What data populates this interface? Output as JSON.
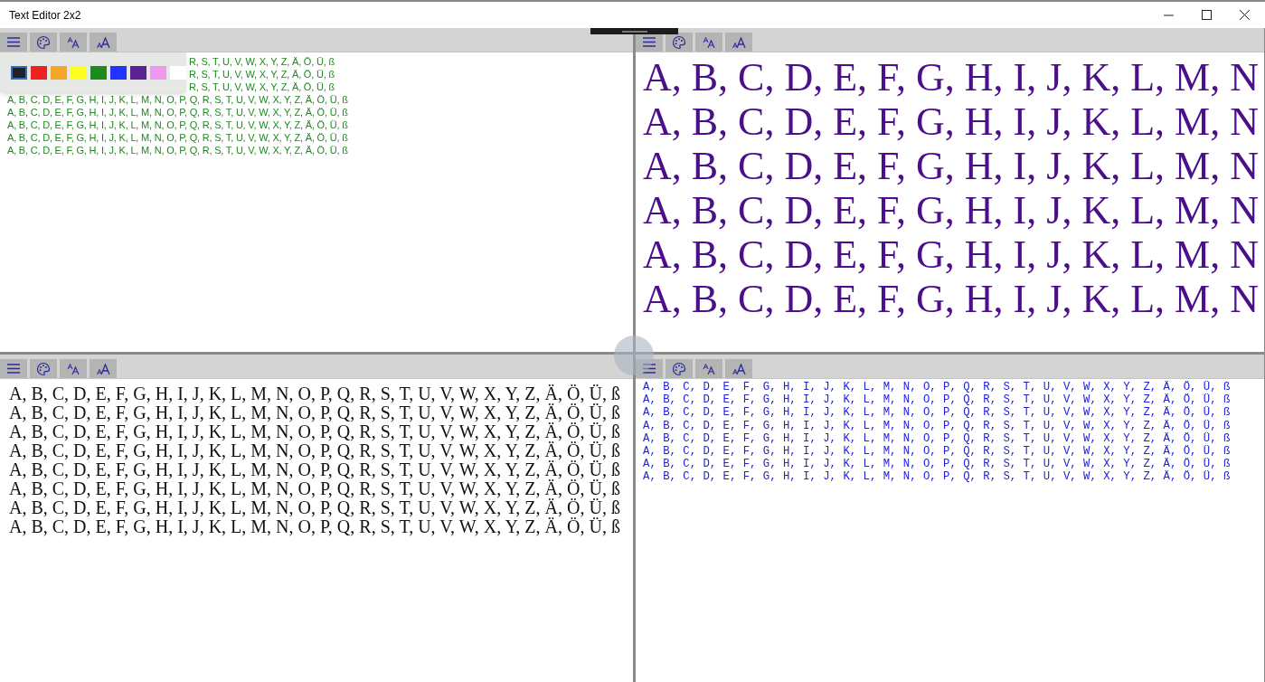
{
  "window": {
    "title": "Text Editor 2x2"
  },
  "panes": [
    {
      "kind": "small-sans",
      "color": "#1e8a1e",
      "color_popup": {
        "swatches": [
          {
            "color": "#222222",
            "selected": true
          },
          {
            "color": "#ee2222",
            "selected": false
          },
          {
            "color": "#f5a623",
            "selected": false
          },
          {
            "color": "#ffff22",
            "selected": false
          },
          {
            "color": "#1e8a1e",
            "selected": false
          },
          {
            "color": "#2233ff",
            "selected": false
          },
          {
            "color": "#5b2293",
            "selected": false
          },
          {
            "color": "#ee99ee",
            "selected": false
          },
          {
            "color": "#ffffff",
            "selected": false
          }
        ]
      },
      "partial_lines": [
        "R, S, T, U, V, W, X, Y, Z, Ä, Ö, Ü, ß",
        "R, S, T, U, V, W, X, Y, Z, Ä, Ö, Ü, ß",
        "R, S, T, U, V, W, X, Y, Z, Ä, Ö, Ü, ß"
      ],
      "lines": [
        "A, B, C, D, E, F, G, H, I, J, K, L, M, N, O, P, Q, R, S, T, U, V, W, X, Y, Z, Ä, Ö, Ü, ß",
        "A, B, C, D, E, F, G, H, I, J, K, L, M, N, O, P, Q, R, S, T, U, V, W, X, Y, Z, Ä, Ö, Ü, ß",
        "A, B, C, D, E, F, G, H, I, J, K, L, M, N, O, P, Q, R, S, T, U, V, W, X, Y, Z, Ä, Ö, Ü, ß",
        "A, B, C, D, E, F, G, H, I, J, K, L, M, N, O, P, Q, R, S, T, U, V, W, X, Y, Z, Ä, Ö, Ü, ß",
        "A, B, C, D, E, F, G, H, I, J, K, L, M, N, O, P, Q, R, S, T, U, V, W, X, Y, Z, Ä, Ö, Ü, ß"
      ]
    },
    {
      "kind": "large-serif",
      "color": "#4b0f8a",
      "lines": [
        "A, B, C, D, E, F, G, H, I, J, K, L, M, N",
        "A, B, C, D, E, F, G, H, I, J, K, L, M, N",
        "A, B, C, D, E, F, G, H, I, J, K, L, M, N",
        "A, B, C, D, E, F, G, H, I, J, K, L, M, N",
        "A, B, C, D, E, F, G, H, I, J, K, L, M, N",
        "A, B, C, D, E, F, G, H, I, J, K, L, M, N"
      ]
    },
    {
      "kind": "serif",
      "color": "#111111",
      "lines": [
        "A, B, C, D, E, F, G, H, I, J, K, L, M, N, O, P, Q, R, S, T, U, V, W, X, Y, Z, Ä, Ö, Ü, ß",
        "A, B, C, D, E, F, G, H, I, J, K, L, M, N, O, P, Q, R, S, T, U, V, W, X, Y, Z, Ä, Ö, Ü, ß",
        "A, B, C, D, E, F, G, H, I, J, K, L, M, N, O, P, Q, R, S, T, U, V, W, X, Y, Z, Ä, Ö, Ü, ß",
        "A, B, C, D, E, F, G, H, I, J, K, L, M, N, O, P, Q, R, S, T, U, V, W, X, Y, Z, Ä, Ö, Ü, ß",
        "A, B, C, D, E, F, G, H, I, J, K, L, M, N, O, P, Q, R, S, T, U, V, W, X, Y, Z, Ä, Ö, Ü, ß",
        "A, B, C, D, E, F, G, H, I, J, K, L, M, N, O, P, Q, R, S, T, U, V, W, X, Y, Z, Ä, Ö, Ü, ß",
        "A, B, C, D, E, F, G, H, I, J, K, L, M, N, O, P, Q, R, S, T, U, V, W, X, Y, Z, Ä, Ö, Ü, ß",
        "A, B, C, D, E, F, G, H, I, J, K, L, M, N, O, P, Q, R, S, T, U, V, W, X, Y, Z, Ä, Ö, Ü, ß"
      ]
    },
    {
      "kind": "mono",
      "color": "#2222dd",
      "lines": [
        "A, B, C, D, E, F, G, H, I, J, K, L, M, N, O, P, Q, R, S, T, U, V, W, X, Y, Z, Ä, Ö, Ü, ß",
        "A, B, C, D, E, F, G, H, I, J, K, L, M, N, O, P, Q, R, S, T, U, V, W, X, Y, Z, Ä, Ö, Ü, ß",
        "A, B, C, D, E, F, G, H, I, J, K, L, M, N, O, P, Q, R, S, T, U, V, W, X, Y, Z, Ä, Ö, Ü, ß",
        "A, B, C, D, E, F, G, H, I, J, K, L, M, N, O, P, Q, R, S, T, U, V, W, X, Y, Z, Ä, Ö, Ü, ß",
        "A, B, C, D, E, F, G, H, I, J, K, L, M, N, O, P, Q, R, S, T, U, V, W, X, Y, Z, Ä, Ö, Ü, ß",
        "A, B, C, D, E, F, G, H, I, J, K, L, M, N, O, P, Q, R, S, T, U, V, W, X, Y, Z, Ä, Ö, Ü, ß",
        "A, B, C, D, E, F, G, H, I, J, K, L, M, N, O, P, Q, R, S, T, U, V, W, X, Y, Z, Ä, Ö, Ü, ß",
        "A, B, C, D, E, F, G, H, I, J, K, L, M, N, O, P, Q, R, S, T, U, V, W, X, Y, Z, Ä, Ö, Ü, ß"
      ]
    }
  ]
}
